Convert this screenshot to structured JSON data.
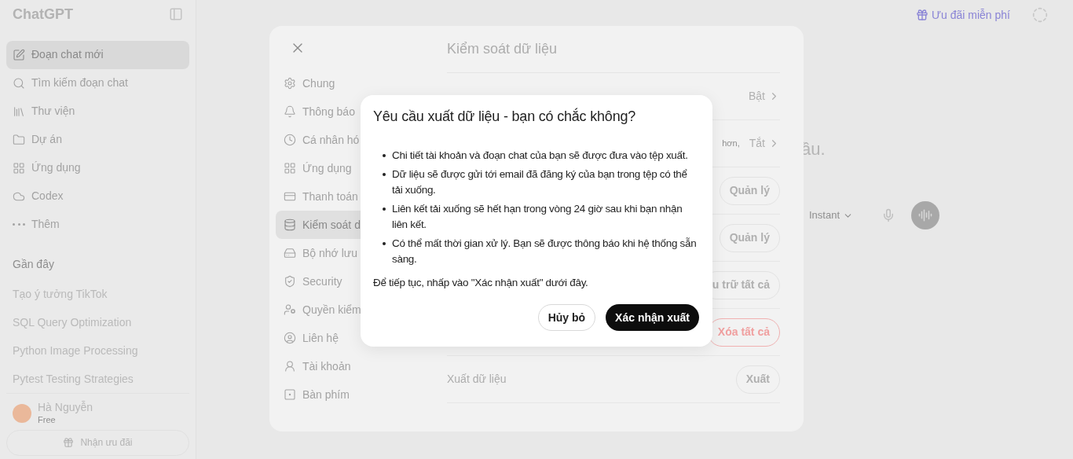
{
  "sidebar": {
    "title": "ChatGPT",
    "items": [
      {
        "label": "Đoạn chat mới",
        "selected": true
      },
      {
        "label": "Tìm kiếm đoạn chat",
        "selected": false
      },
      {
        "label": "Thư viện",
        "selected": false
      },
      {
        "label": "Dự án",
        "selected": false
      },
      {
        "label": "Ứng dụng",
        "selected": false
      },
      {
        "label": "Codex",
        "selected": false
      },
      {
        "label": "Thêm",
        "selected": false
      }
    ],
    "recent_heading": "Gần đây",
    "recent": [
      "Tạo ý tưởng TikTok",
      "SQL Query Optimization",
      "Python Image Processing",
      "Pytest Testing Strategies"
    ],
    "user": {
      "name": "Hà Nguyễn",
      "plan": "Free"
    },
    "promo_button": "Nhận ưu đãi"
  },
  "header": {
    "promo": "Ưu đãi miễn phí"
  },
  "main": {
    "heading_fragment": "ầu.",
    "model": "Instant"
  },
  "settings": {
    "nav": [
      {
        "label": "Chung",
        "selected": false
      },
      {
        "label": "Thông báo",
        "selected": false
      },
      {
        "label": "Cá nhân hó",
        "selected": false
      },
      {
        "label": "Ứng dụng",
        "selected": false
      },
      {
        "label": "Thanh toán",
        "selected": false
      },
      {
        "label": "Kiểm soát d",
        "selected": true
      },
      {
        "label": "Bộ nhớ lưu",
        "selected": false
      },
      {
        "label": "Security",
        "selected": false
      },
      {
        "label": "Quyền kiểm",
        "selected": false
      },
      {
        "label": "Liên hệ",
        "selected": false
      },
      {
        "label": "Tài khoản",
        "selected": false
      },
      {
        "label": "Bàn phím",
        "selected": false
      }
    ],
    "title": "Kiểm soát dữ liệu",
    "rows": [
      {
        "kind": "link",
        "value": "Bật"
      },
      {
        "kind": "link",
        "hint": "hơn,",
        "value": "Tắt"
      },
      {
        "kind": "button",
        "action": "Quản lý"
      },
      {
        "kind": "button",
        "action": "Quản lý"
      },
      {
        "kind": "button",
        "action": "u trữ tất cả"
      },
      {
        "kind": "danger",
        "action": "Xóa tất cả"
      },
      {
        "kind": "button",
        "label": "Xuất dữ liệu",
        "action": "Xuất"
      }
    ]
  },
  "dialog": {
    "title": "Yêu cầu xuất dữ liệu - bạn có chắc không?",
    "bullets": [
      "Chi tiết tài khoản và đoạn chat của bạn sẽ được đưa vào tệp xuất.",
      "Dữ liệu sẽ được gửi tới email đã đăng ký của bạn trong tệp có thể tải xuống.",
      "Liên kết tải xuống sẽ hết hạn trong vòng 24 giờ sau khi bạn nhận liên kết.",
      "Có thể mất thời gian xử lý. Bạn sẽ được thông báo khi hệ thống sẵn sàng."
    ],
    "note": "Để tiếp tục, nhấp vào \"Xác nhận xuất\" dưới đây.",
    "buttons": [
      {
        "label": "Hủy bỏ",
        "kind": "secondary"
      },
      {
        "label": "Xác nhận xuất",
        "kind": "primary"
      }
    ]
  }
}
